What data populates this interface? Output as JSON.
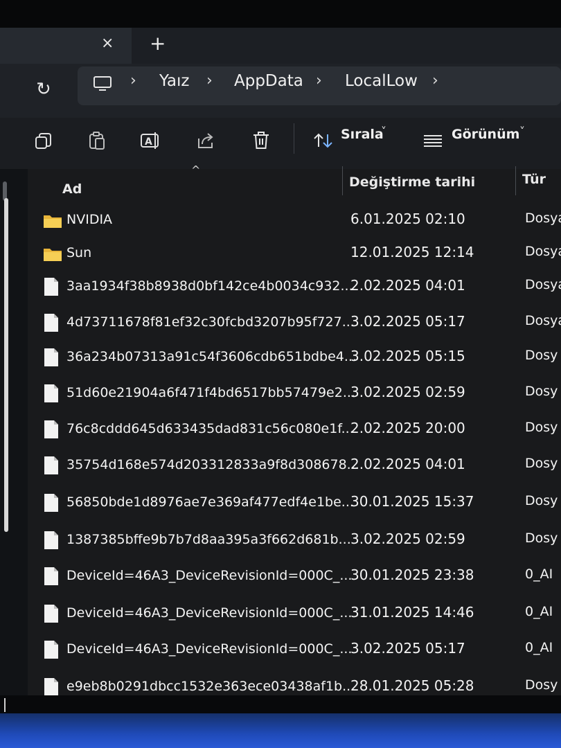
{
  "tabs": {
    "close_icon": "×",
    "new_tab_icon": "+"
  },
  "address": {
    "refresh_icon": "↻",
    "separator": "›",
    "crumbs": [
      "Yaız",
      "AppData",
      "LocalLow"
    ]
  },
  "toolbar": {
    "sort_label": "Sırala",
    "view_label": "Görünüm",
    "dropdown_icon": "˅"
  },
  "columns": {
    "name": "Ad",
    "modified": "Değiştirme tarihi",
    "type": "Tür",
    "sort_indicator": "^"
  },
  "files": [
    {
      "kind": "folder",
      "name": "NVIDIA",
      "modified": "6.01.2025 02:10",
      "type": "Dosya"
    },
    {
      "kind": "folder",
      "name": "Sun",
      "modified": "12.01.2025 12:14",
      "type": "Dosya"
    },
    {
      "kind": "file",
      "name": "3aa1934f38b8938d0bf142ce4b0034c932...",
      "modified": "2.02.2025 04:01",
      "type": "Dosya"
    },
    {
      "kind": "file",
      "name": "4d73711678f81ef32c30fcbd3207b95f727...",
      "modified": "3.02.2025 05:17",
      "type": "Dosya"
    },
    {
      "kind": "file",
      "name": "36a234b07313a91c54f3606cdb651bdbe4...",
      "modified": "3.02.2025 05:15",
      "type": "Dosy"
    },
    {
      "kind": "file",
      "name": "51d60e21904a6f471f4bd6517bb57479e2...",
      "modified": "3.02.2025 02:59",
      "type": "Dosy"
    },
    {
      "kind": "file",
      "name": "76c8cddd645d633435dad831c56c080e1f...",
      "modified": "2.02.2025 20:00",
      "type": "Dosy"
    },
    {
      "kind": "file",
      "name": "35754d168e574d203312833a9f8d308678...",
      "modified": "2.02.2025 04:01",
      "type": "Dosy"
    },
    {
      "kind": "file",
      "name": "56850bde1d8976ae7e369af477edf4e1be...",
      "modified": "30.01.2025 15:37",
      "type": "Dosy"
    },
    {
      "kind": "file",
      "name": "1387385bffe9b7b7d8aa395a3f662d681b...",
      "modified": "3.02.2025 02:59",
      "type": "Dosy"
    },
    {
      "kind": "file",
      "name": "DeviceId=46A3_DeviceRevisionId=000C_...",
      "modified": "30.01.2025 23:38",
      "type": "0_AI"
    },
    {
      "kind": "file",
      "name": "DeviceId=46A3_DeviceRevisionId=000C_...",
      "modified": "31.01.2025 14:46",
      "type": "0_AI"
    },
    {
      "kind": "file",
      "name": "DeviceId=46A3_DeviceRevisionId=000C_...",
      "modified": "3.02.2025 05:17",
      "type": "0_AI"
    },
    {
      "kind": "file",
      "name": "e9eb8b0291dbcc1532e363ece03438af1b...",
      "modified": "28.01.2025 05:28",
      "type": "Dosy"
    }
  ]
}
